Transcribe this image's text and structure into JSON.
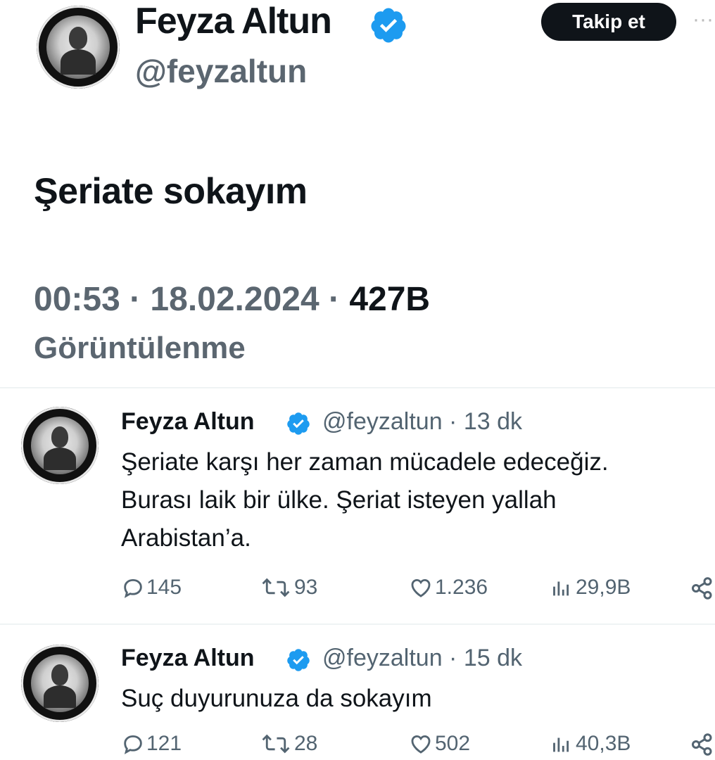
{
  "main_tweet": {
    "author_name": "Feyza Altun",
    "handle": "@feyzaltun",
    "follow_label": "Takip et",
    "more_label": "···",
    "text": "Şeriate sokayım",
    "time": "00:53",
    "date": "18.02.2024",
    "views": "427B",
    "views_label": "Görüntülenme",
    "separator": " · "
  },
  "replies": [
    {
      "author_name": "Feyza Altun",
      "handle": "@feyzaltun",
      "age": "13 dk",
      "lines": [
        "Şeriate karşı her zaman mücadele edeceğiz.",
        "Burası laik bir ülke. Şeriat isteyen yallah",
        "Arabistan’a."
      ],
      "replies_count": "145",
      "retweets_count": "93",
      "likes_count": "1.236",
      "views_count": "29,9B"
    },
    {
      "author_name": "Feyza Altun",
      "handle": "@feyzaltun",
      "age": "15 dk",
      "lines": [
        "Suç duyurunuza da sokayım"
      ],
      "replies_count": "121",
      "retweets_count": "28",
      "likes_count": "502",
      "views_count": "40,3B"
    }
  ],
  "icons": {
    "verified": "verified-badge-icon",
    "reply": "reply-icon",
    "retweet": "retweet-icon",
    "like": "heart-icon",
    "views": "views-icon",
    "share": "share-icon",
    "more": "more-icon"
  },
  "colors": {
    "verified_blue": "#1d9bf0",
    "text_primary": "#0f1419",
    "text_secondary": "#536471",
    "button_bg": "#0f1419"
  }
}
